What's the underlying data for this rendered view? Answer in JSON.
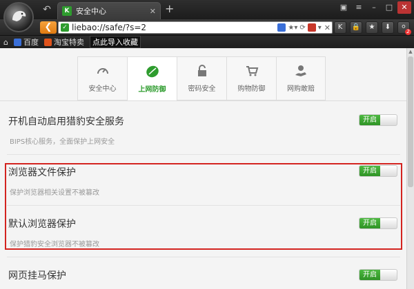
{
  "browser": {
    "tab_title": "安全中心",
    "tab_favicon_letter": "K",
    "new_tab": "+",
    "url": "liebao://safe/?s=2",
    "badge_count": "2",
    "bookmarks": [
      {
        "label": "百度",
        "color": "#3a6fd8"
      },
      {
        "label": "淘宝特卖",
        "color": "#e0531c"
      },
      {
        "label": "点此导入收藏",
        "color": ""
      }
    ]
  },
  "nav_tabs": [
    {
      "label": "安全中心",
      "icon": "speedometer-icon"
    },
    {
      "label": "上网防御",
      "icon": "leaf-shield-icon",
      "active": true
    },
    {
      "label": "密码安全",
      "icon": "lock-icon"
    },
    {
      "label": "购物防御",
      "icon": "cart-icon"
    },
    {
      "label": "网购敢赔",
      "icon": "money-hand-icon"
    }
  ],
  "settings": [
    {
      "title": "开机自动启用猎豹安全服务",
      "desc": "BIPS核心服务，全面保护上网安全",
      "toggle": "开启"
    },
    {
      "title": "浏览器文件保护",
      "desc": "保护浏览器相关设置不被篡改",
      "toggle": "开启"
    },
    {
      "title": "默认浏览器保护",
      "desc": "保护猎豹安全浏览器不被篡改",
      "toggle": "开启"
    },
    {
      "title": "网页挂马保护",
      "desc": "",
      "toggle": "开启"
    }
  ],
  "colors": {
    "accent_green": "#2e9c2e",
    "highlight_red": "#d3231f",
    "back_orange": "#f08a1e"
  }
}
